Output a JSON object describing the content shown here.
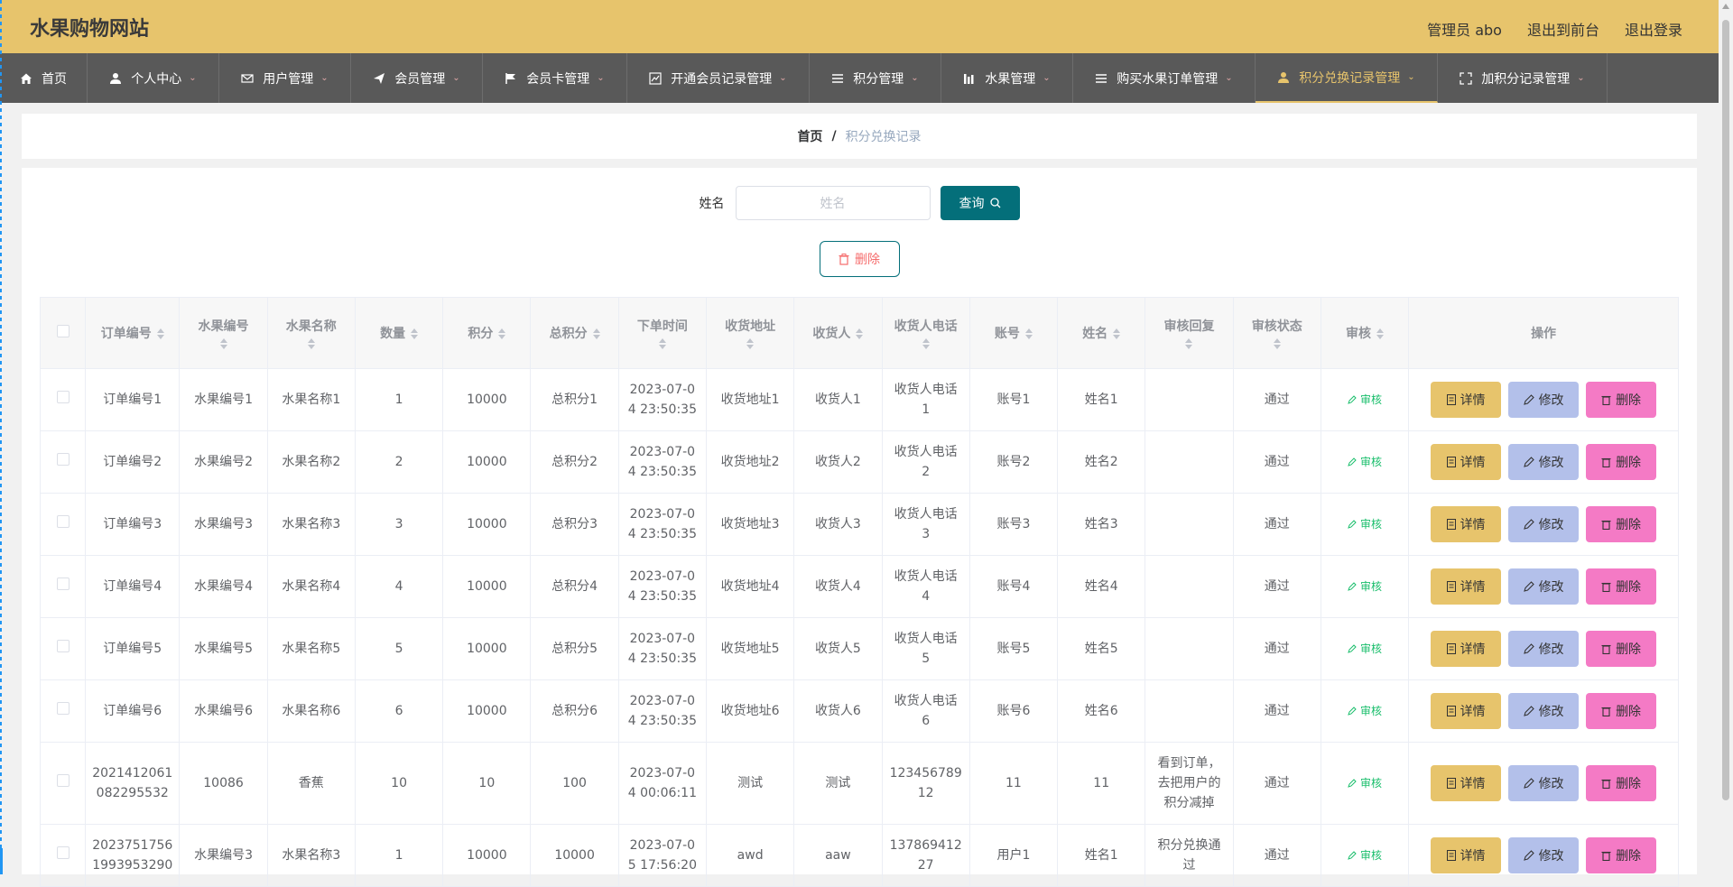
{
  "header": {
    "brand": "水果购物网站",
    "admin_label": "管理员 abo",
    "to_front_label": "退出到前台",
    "logout_label": "退出登录"
  },
  "nav": {
    "items": [
      {
        "label": "首页",
        "icon": "home-icon",
        "has_menu": false
      },
      {
        "label": "个人中心",
        "icon": "user-icon",
        "has_menu": true
      },
      {
        "label": "用户管理",
        "icon": "mail-icon",
        "has_menu": true
      },
      {
        "label": "会员管理",
        "icon": "paper-plane-icon",
        "has_menu": true
      },
      {
        "label": "会员卡管理",
        "icon": "flag-icon",
        "has_menu": true
      },
      {
        "label": "开通会员记录管理",
        "icon": "chart-icon",
        "has_menu": true
      },
      {
        "label": "积分管理",
        "icon": "list-icon",
        "has_menu": true
      },
      {
        "label": "水果管理",
        "icon": "bar-chart-icon",
        "has_menu": true
      },
      {
        "label": "购买水果订单管理",
        "icon": "list-icon",
        "has_menu": true
      },
      {
        "label": "积分兑换记录管理",
        "icon": "user-icon",
        "has_menu": true,
        "active": true
      },
      {
        "label": "加积分记录管理",
        "icon": "fullscreen-icon",
        "has_menu": true
      }
    ]
  },
  "breadcrumb": {
    "home": "首页",
    "separator": "/",
    "current": "积分兑换记录"
  },
  "search": {
    "label": "姓名",
    "placeholder": "姓名",
    "value": "",
    "button_label": "查询"
  },
  "toolbar": {
    "delete_label": "删除"
  },
  "table": {
    "columns": [
      "订单编号",
      "水果编号",
      "水果名称",
      "数量",
      "积分",
      "总积分",
      "下单时间",
      "收货地址",
      "收货人",
      "收货人电话",
      "账号",
      "姓名",
      "审核回复",
      "审核状态",
      "审核",
      "操作"
    ],
    "audit_label": "审核",
    "detail_label": "详情",
    "edit_label": "修改",
    "delete_label": "删除",
    "rows": [
      {
        "order": "订单编号1",
        "fruit_no": "水果编号1",
        "fruit_name": "水果名称1",
        "qty": "1",
        "points": "10000",
        "total": "总积分1",
        "time": "2023-07-0\n4 23:50:35",
        "address": "收货地址1",
        "receiver": "收货人1",
        "phone": "收货人电话\n1",
        "account": "账号1",
        "name": "姓名1",
        "reply": "",
        "status": "通过"
      },
      {
        "order": "订单编号2",
        "fruit_no": "水果编号2",
        "fruit_name": "水果名称2",
        "qty": "2",
        "points": "10000",
        "total": "总积分2",
        "time": "2023-07-0\n4 23:50:35",
        "address": "收货地址2",
        "receiver": "收货人2",
        "phone": "收货人电话\n2",
        "account": "账号2",
        "name": "姓名2",
        "reply": "",
        "status": "通过"
      },
      {
        "order": "订单编号3",
        "fruit_no": "水果编号3",
        "fruit_name": "水果名称3",
        "qty": "3",
        "points": "10000",
        "total": "总积分3",
        "time": "2023-07-0\n4 23:50:35",
        "address": "收货地址3",
        "receiver": "收货人3",
        "phone": "收货人电话\n3",
        "account": "账号3",
        "name": "姓名3",
        "reply": "",
        "status": "通过"
      },
      {
        "order": "订单编号4",
        "fruit_no": "水果编号4",
        "fruit_name": "水果名称4",
        "qty": "4",
        "points": "10000",
        "total": "总积分4",
        "time": "2023-07-0\n4 23:50:35",
        "address": "收货地址4",
        "receiver": "收货人4",
        "phone": "收货人电话\n4",
        "account": "账号4",
        "name": "姓名4",
        "reply": "",
        "status": "通过"
      },
      {
        "order": "订单编号5",
        "fruit_no": "水果编号5",
        "fruit_name": "水果名称5",
        "qty": "5",
        "points": "10000",
        "total": "总积分5",
        "time": "2023-07-0\n4 23:50:35",
        "address": "收货地址5",
        "receiver": "收货人5",
        "phone": "收货人电话\n5",
        "account": "账号5",
        "name": "姓名5",
        "reply": "",
        "status": "通过"
      },
      {
        "order": "订单编号6",
        "fruit_no": "水果编号6",
        "fruit_name": "水果名称6",
        "qty": "6",
        "points": "10000",
        "total": "总积分6",
        "time": "2023-07-0\n4 23:50:35",
        "address": "收货地址6",
        "receiver": "收货人6",
        "phone": "收货人电话\n6",
        "account": "账号6",
        "name": "姓名6",
        "reply": "",
        "status": "通过"
      },
      {
        "order": "2021412061\n082295532",
        "fruit_no": "10086",
        "fruit_name": "香蕉",
        "qty": "10",
        "points": "10",
        "total": "100",
        "time": "2023-07-0\n4 00:06:11",
        "address": "测试",
        "receiver": "测试",
        "phone": "123456789\n12",
        "account": "11",
        "name": "11",
        "reply": "看到订单，\n去把用户的\n积分减掉",
        "status": "通过",
        "tall": true
      },
      {
        "order": "2023751756\n1993953290",
        "fruit_no": "水果编号3",
        "fruit_name": "水果名称3",
        "qty": "1",
        "points": "10000",
        "total": "10000",
        "time": "2023-07-0\n5 17:56:20",
        "address": "awd",
        "receiver": "aaw",
        "phone": "137869412\n27",
        "account": "用户1",
        "name": "姓名1",
        "reply": "积分兑换通\n过",
        "status": "通过"
      }
    ]
  },
  "colors": {
    "header_bg": "#e7c46c",
    "nav_bg": "#595959",
    "primary": "#046f7a",
    "detail_btn": "#e7c46c",
    "edit_btn": "#b3c0ea",
    "delete_btn": "#f47ac5",
    "audit_link": "#19be6b"
  }
}
